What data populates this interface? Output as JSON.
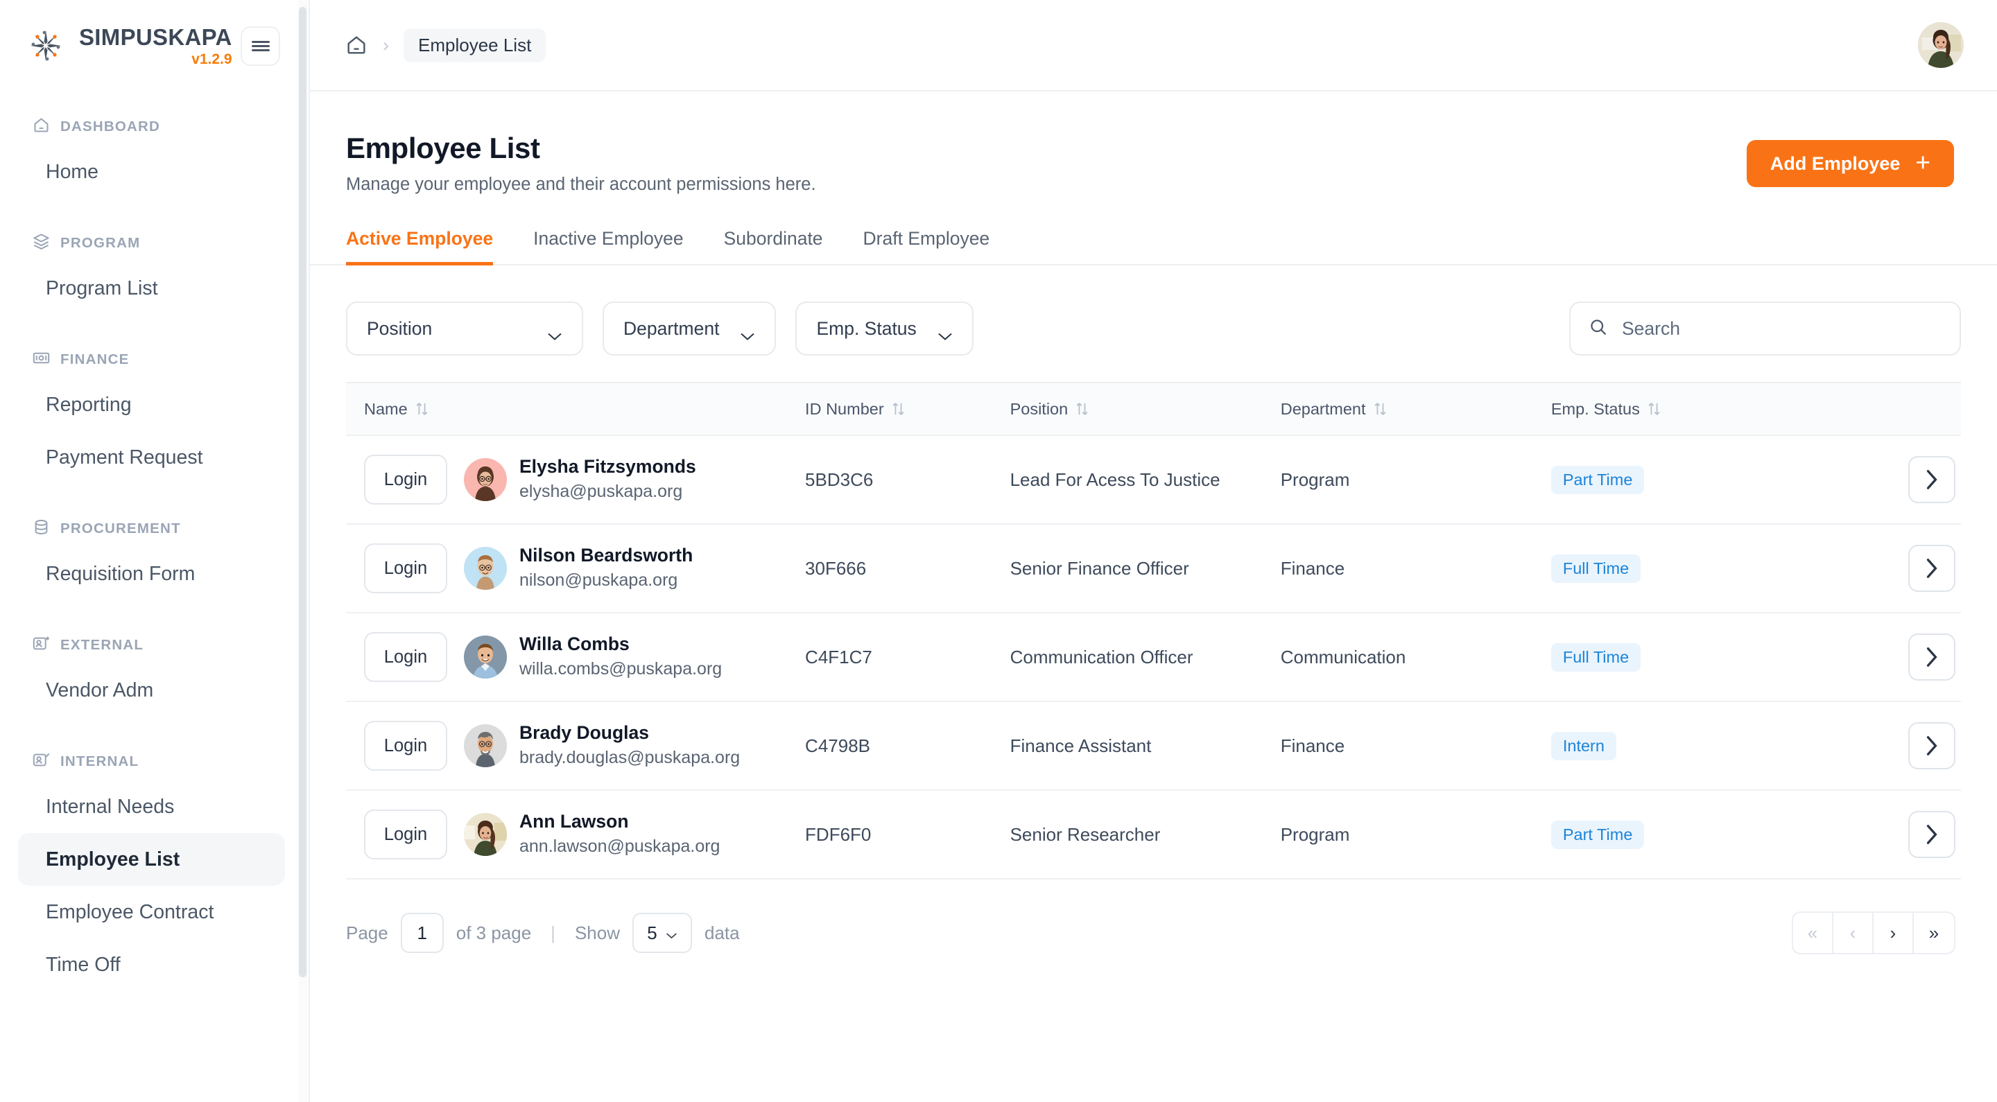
{
  "brand": {
    "name": "SIMPUSKAPA",
    "version": "v1.2.9",
    "logo_icon": "sun-people-logo-icon",
    "menu_toggle_icon": "hamburger-icon"
  },
  "sidebar": {
    "sections": [
      {
        "title": "DASHBOARD",
        "icon": "home-icon",
        "items": [
          {
            "label": "Home",
            "active": false
          }
        ]
      },
      {
        "title": "PROGRAM",
        "icon": "layers-icon",
        "items": [
          {
            "label": "Program List",
            "active": false
          }
        ]
      },
      {
        "title": "FINANCE",
        "icon": "banknote-icon",
        "items": [
          {
            "label": "Reporting",
            "active": false
          },
          {
            "label": "Payment Request",
            "active": false
          }
        ]
      },
      {
        "title": "PROCUREMENT",
        "icon": "database-icon",
        "items": [
          {
            "label": "Requisition Form",
            "active": false
          }
        ]
      },
      {
        "title": "EXTERNAL",
        "icon": "user-share-icon",
        "items": [
          {
            "label": "Vendor Adm",
            "active": false
          }
        ]
      },
      {
        "title": "INTERNAL",
        "icon": "user-check-icon",
        "items": [
          {
            "label": "Internal Needs",
            "active": false
          },
          {
            "label": "Employee List",
            "active": true
          },
          {
            "label": "Employee Contract",
            "active": false
          },
          {
            "label": "Time Off",
            "active": false
          }
        ]
      }
    ]
  },
  "topbar": {
    "breadcrumb": {
      "home_icon": "home-icon",
      "separator": "›",
      "current": "Employee List"
    },
    "avatar_icon": "user-avatar"
  },
  "page": {
    "title": "Employee List",
    "subtitle": "Manage your employee and their account permissions here.",
    "add_button": {
      "label": "Add Employee",
      "icon": "plus-icon"
    }
  },
  "tabs": [
    {
      "label": "Active Employee",
      "active": true
    },
    {
      "label": "Inactive Employee",
      "active": false
    },
    {
      "label": "Subordinate",
      "active": false
    },
    {
      "label": "Draft Employee",
      "active": false
    }
  ],
  "filters": {
    "position": {
      "label": "Position",
      "icon": "chevron-down-icon"
    },
    "department": {
      "label": "Department",
      "icon": "chevron-down-icon"
    },
    "emp_status": {
      "label": "Emp. Status",
      "icon": "chevron-down-icon"
    },
    "search": {
      "placeholder": "Search",
      "value": "",
      "icon": "search-icon"
    }
  },
  "table": {
    "columns": [
      {
        "label": "Name",
        "sortable": true
      },
      {
        "label": "ID Number",
        "sortable": true
      },
      {
        "label": "Position",
        "sortable": true
      },
      {
        "label": "Department",
        "sortable": true
      },
      {
        "label": "Emp. Status",
        "sortable": true
      }
    ],
    "login_label": "Login",
    "row_action_icon": "chevron-right-icon",
    "rows": [
      {
        "name": "Elysha Fitzsymonds",
        "email": "elysha@puskapa.org",
        "id_number": "5BD3C6",
        "position": "Lead For Acess To Justice",
        "department": "Program",
        "emp_status": "Part Time",
        "avatar_bg": "#f9b7b0"
      },
      {
        "name": "Nilson Beardsworth",
        "email": "nilson@puskapa.org",
        "id_number": "30F666",
        "position": "Senior Finance Officer",
        "department": "Finance",
        "emp_status": "Full Time",
        "avatar_bg": "#bfe3f5"
      },
      {
        "name": "Willa Combs",
        "email": "willa.combs@puskapa.org",
        "id_number": "C4F1C7",
        "position": "Communication Officer",
        "department": "Communication",
        "emp_status": "Full Time",
        "avatar_bg": "#7f94a6"
      },
      {
        "name": "Brady Douglas",
        "email": "brady.douglas@puskapa.org",
        "id_number": "C4798B",
        "position": "Finance Assistant",
        "department": "Finance",
        "emp_status": "Intern",
        "avatar_bg": "#dcdcdc"
      },
      {
        "name": "Ann Lawson",
        "email": "ann.lawson@puskapa.org",
        "id_number": "FDF6F0",
        "position": "Senior Researcher",
        "department": "Program",
        "emp_status": "Part Time",
        "avatar_bg": "#e9dfc6"
      }
    ]
  },
  "pagination": {
    "page_label": "Page",
    "page_value": "1",
    "of_label": "of 3 page",
    "divider": "|",
    "show_label": "Show",
    "show_value": "5",
    "data_label": "data",
    "first_icon": "chevron-double-left-icon",
    "prev_icon": "chevron-left-icon",
    "next_icon": "chevron-right-icon",
    "last_icon": "chevron-double-right-icon",
    "first_glyph": "«",
    "prev_glyph": "‹",
    "next_glyph": "›",
    "last_glyph": "»"
  },
  "colors": {
    "accent": "#f97316",
    "badge_text": "#1c84d6",
    "badge_bg": "#eaf4fd",
    "sidebar_section": "#9aa5b5",
    "text_primary": "#111827"
  }
}
